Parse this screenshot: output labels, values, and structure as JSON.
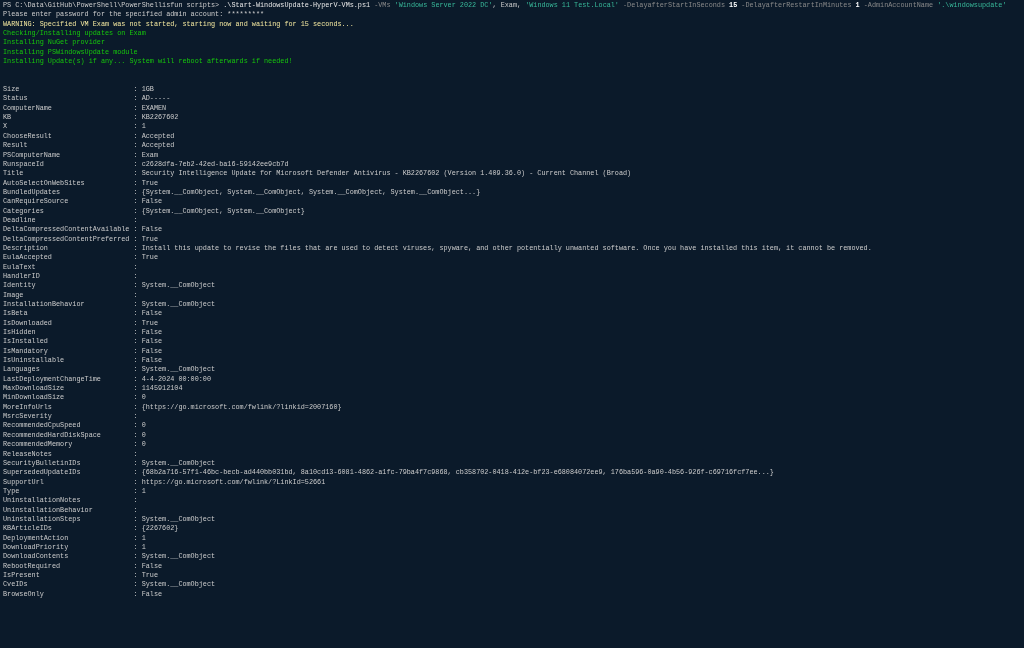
{
  "command_line": [
    {
      "kind": "prompt",
      "text": "PS C:\\Data\\GitHub\\PowerShell\\PowerShellisfun scripts> "
    },
    {
      "kind": "command",
      "text": ".\\Start-WindowsUpdate-HyperV-VMs.ps1"
    },
    {
      "kind": "parameter",
      "text": " -VMs "
    },
    {
      "kind": "string",
      "text": "'Windows Server 2022 DC'"
    },
    {
      "kind": "plain",
      "text": ", Exam, "
    },
    {
      "kind": "string",
      "text": "'Windows 11 Test.Local'"
    },
    {
      "kind": "parameter",
      "text": " -DelayafterStartInSeconds "
    },
    {
      "kind": "number",
      "text": "15"
    },
    {
      "kind": "parameter",
      "text": " -DelayafterRestartInMinutes "
    },
    {
      "kind": "number",
      "text": "1"
    },
    {
      "kind": "parameter",
      "text": " -AdminAccountName "
    },
    {
      "kind": "string",
      "text": "'.\\windowsupdate'"
    }
  ],
  "output_lines": [
    {
      "kind": "plain",
      "text": "Please enter password for the specified admin account: *********"
    },
    {
      "kind": "warning",
      "text": "WARNING: Specified VM Exam was not started, starting now and waiting for 15 seconds..."
    },
    {
      "kind": "success",
      "text": "Checking/Installing updates on Exam"
    },
    {
      "kind": "success",
      "text": "Installing NuGet provider"
    },
    {
      "kind": "success",
      "text": "Installing PSWindowsUpdate module"
    },
    {
      "kind": "success",
      "text": "Installing Update(s) if any... System will reboot afterwards if needed!"
    }
  ],
  "separator": ":",
  "properties": [
    {
      "name": "Size",
      "value": "1GB"
    },
    {
      "name": "Status",
      "value": "AD-----"
    },
    {
      "name": "ComputerName",
      "value": "EXAMEN"
    },
    {
      "name": "KB",
      "value": "KB2267602"
    },
    {
      "name": "X",
      "value": "1"
    },
    {
      "name": "ChooseResult",
      "value": "Accepted"
    },
    {
      "name": "Result",
      "value": "Accepted"
    },
    {
      "name": "PSComputerName",
      "value": "Exam"
    },
    {
      "name": "RunspaceId",
      "value": "c2628dfa-7eb2-42ed-ba16-59142ee9cb7d"
    },
    {
      "name": "Title",
      "value": "Security Intelligence Update for Microsoft Defender Antivirus - KB2267602 (Version 1.409.36.0) - Current Channel (Broad)"
    },
    {
      "name": "AutoSelectOnWebSites",
      "value": "True"
    },
    {
      "name": "BundledUpdates",
      "value": "{System.__ComObject, System.__ComObject, System.__ComObject, System.__ComObject...}"
    },
    {
      "name": "CanRequireSource",
      "value": "False"
    },
    {
      "name": "Categories",
      "value": "{System.__ComObject, System.__ComObject}"
    },
    {
      "name": "Deadline"
    },
    {
      "name": "DeltaCompressedContentAvailable",
      "value": "False"
    },
    {
      "name": "DeltaCompressedContentPreferred",
      "value": "True"
    },
    {
      "name": "Description",
      "value": "Install this update to revise the files that are used to detect viruses, spyware, and other potentially unwanted software. Once you have installed this item, it cannot be removed."
    },
    {
      "name": "EulaAccepted",
      "value": "True"
    },
    {
      "name": "EulaText"
    },
    {
      "name": "HandlerID"
    },
    {
      "name": "Identity",
      "value": "System.__ComObject"
    },
    {
      "name": "Image"
    },
    {
      "name": "InstallationBehavior",
      "value": "System.__ComObject"
    },
    {
      "name": "IsBeta",
      "value": "False"
    },
    {
      "name": "IsDownloaded",
      "value": "True"
    },
    {
      "name": "IsHidden",
      "value": "False"
    },
    {
      "name": "IsInstalled",
      "value": "False"
    },
    {
      "name": "IsMandatory",
      "value": "False"
    },
    {
      "name": "IsUninstallable",
      "value": "False"
    },
    {
      "name": "Languages",
      "value": "System.__ComObject"
    },
    {
      "name": "LastDeploymentChangeTime",
      "value": "4-4-2024 00:00:00"
    },
    {
      "name": "MaxDownloadSize",
      "value": "1145912104"
    },
    {
      "name": "MinDownloadSize",
      "value": "0"
    },
    {
      "name": "MoreInfoUrls",
      "value": "{https://go.microsoft.com/fwlink/?linkid=2007160}"
    },
    {
      "name": "MsrcSeverity"
    },
    {
      "name": "RecommendedCpuSpeed",
      "value": "0"
    },
    {
      "name": "RecommendedHardDiskSpace",
      "value": "0"
    },
    {
      "name": "RecommendedMemory",
      "value": "0"
    },
    {
      "name": "ReleaseNotes"
    },
    {
      "name": "SecurityBulletinIDs",
      "value": "System.__ComObject"
    },
    {
      "name": "SupersededUpdateIDs",
      "value": "{68b2a716-57f1-46bc-becb-ad440bb031bd, 8a10cd13-6081-4862-a1fc-79ba4f7c9868, cb358702-0418-412e-bf23-e68084072ee9, 176ba596-0a90-4b56-926f-c69716fcf7ee...}"
    },
    {
      "name": "SupportUrl",
      "value": "https://go.microsoft.com/fwlink/?LinkId=52661"
    },
    {
      "name": "Type",
      "value": "1"
    },
    {
      "name": "UninstallationNotes"
    },
    {
      "name": "UninstallationBehavior"
    },
    {
      "name": "UninstallationSteps",
      "value": "System.__ComObject"
    },
    {
      "name": "KBArticleIDs",
      "value": "{2267602}"
    },
    {
      "name": "DeploymentAction",
      "value": "1"
    },
    {
      "name": "DownloadPriority",
      "value": "1"
    },
    {
      "name": "DownloadContents",
      "value": "System.__ComObject"
    },
    {
      "name": "RebootRequired",
      "value": "False"
    },
    {
      "name": "IsPresent",
      "value": "True"
    },
    {
      "name": "CveIDs",
      "value": "System.__ComObject"
    },
    {
      "name": "BrowseOnly",
      "value": "False"
    }
  ]
}
